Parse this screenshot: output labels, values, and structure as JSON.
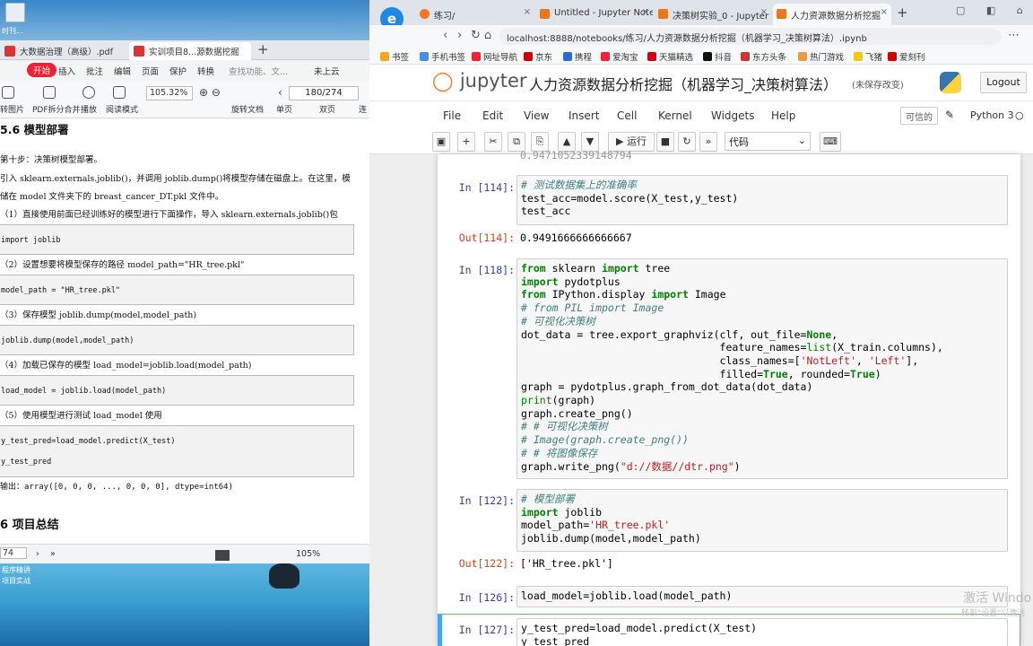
{
  "desktop": {
    "icon_label": "时刊..."
  },
  "pdf": {
    "tabs": [
      {
        "label": "大数据治理（高级）.pdf"
      },
      {
        "label": "实训项目8...源数据挖掘"
      }
    ],
    "menu": [
      "开始",
      "插入",
      "批注",
      "编辑",
      "页面",
      "保护",
      "转换",
      "查找功能、文...",
      "未上云"
    ],
    "tools": [
      "转图片",
      "PDF拆分合并",
      "播放",
      "阅读模式",
      "旋转文档",
      "单页",
      "双页",
      "连"
    ],
    "zoom": "105.32%",
    "page": "180/274",
    "section_title": "5.6 模型部署",
    "lines": {
      "l1": "第十步：决策树模型部署。",
      "l2": "引入 sklearn.externals.joblib()，并调用 joblib.dump()将模型存储在磁盘上。在这里，模",
      "l3": "储在 model 文件夹下的 breast_cancer_DT.pkl 文件中。",
      "l4": "（1）直接使用前面已经训练好的模型进行下面操作，导入 sklearn.externals.joblib()包",
      "c1": "import joblib",
      "l5": "（2）设置想要将模型保存的路径 model_path=\"HR_tree.pkl\"",
      "c2": "model_path = \"HR_tree.pkl\"",
      "l6": "（3）保存模型 joblib.dump(model,model_path)",
      "c3": "joblib.dump(model,model_path)",
      "l7": "（4）加载已保存的模型 load_model=joblib.load(model_path)",
      "c4": "load_model = joblib.load(model_path)",
      "l8": "（5）使用模型进行测试 load_model 使用",
      "c5a": "y_test_pred=load_model.predict(X_test)",
      "c5b": "y_test_pred",
      "l9": "输出：array([0, 0, 0, ..., 0, 0, 0], dtype=int64)",
      "section2": "6 项目总结"
    },
    "status": {
      "page": "74",
      "zoom": "105%"
    },
    "photo_label1": "程序精讲",
    "photo_label2": "项目实战"
  },
  "browser": {
    "tabs": [
      {
        "label": "练习/"
      },
      {
        "label": "Untitled - Jupyter Note"
      },
      {
        "label": "决策树实验_0 - Jupyter"
      },
      {
        "label": "人力资源数据分析挖掘"
      }
    ],
    "url": "localhost:8888/notebooks/练习/人力资源数据分析挖掘（机器学习_决策树算法）.ipynb",
    "bookmarks": [
      "书签",
      "手机书签",
      "网址导航",
      "京东",
      "携程",
      "爱淘宝",
      "天猫精选",
      "抖音",
      "东方头条",
      "热门游戏",
      "飞猪",
      "爱刻刊"
    ]
  },
  "jupyter": {
    "logo": "jupyter",
    "title": "人力资源数据分析挖掘（机器学习_决策树算法）",
    "save_status": "(未保存改变)",
    "logout": "Logout",
    "menu": [
      "File",
      "Edit",
      "View",
      "Insert",
      "Cell",
      "Kernel",
      "Widgets",
      "Help"
    ],
    "trusted": "可信的",
    "kernel": "Python 3",
    "run_label": "运行",
    "cell_type": "代码",
    "top_output": "0.9471052339148794",
    "cells": [
      {
        "prompt": "In [114]:",
        "out_prompt": "Out[114]:",
        "output": "0.9491666666666667"
      },
      {
        "prompt": "In [118]:"
      },
      {
        "prompt": "In [122]:",
        "out_prompt": "Out[122]:",
        "output": "['HR_tree.pkl']"
      },
      {
        "prompt": "In [126]:"
      },
      {
        "prompt": "In [127]:"
      }
    ]
  },
  "windows": {
    "line1": "激活 Windo",
    "line2": "转到\"设置\"以激活"
  }
}
